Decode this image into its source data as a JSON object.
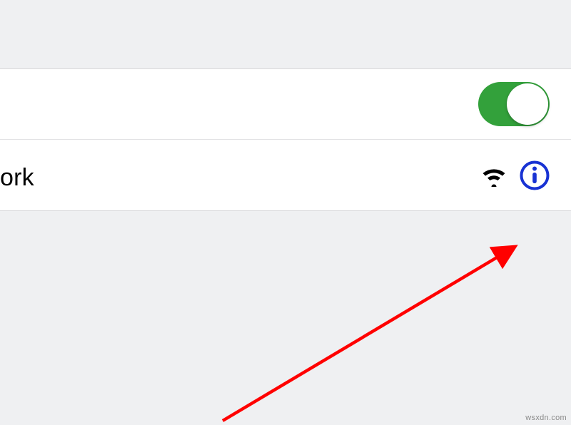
{
  "rows": {
    "wifi_toggle": {
      "on": true
    },
    "network": {
      "label_fragment": "ork"
    }
  },
  "annotation": {
    "arrow_color": "#ff0000",
    "target": "info-icon"
  },
  "watermark": "wsxdn.com"
}
